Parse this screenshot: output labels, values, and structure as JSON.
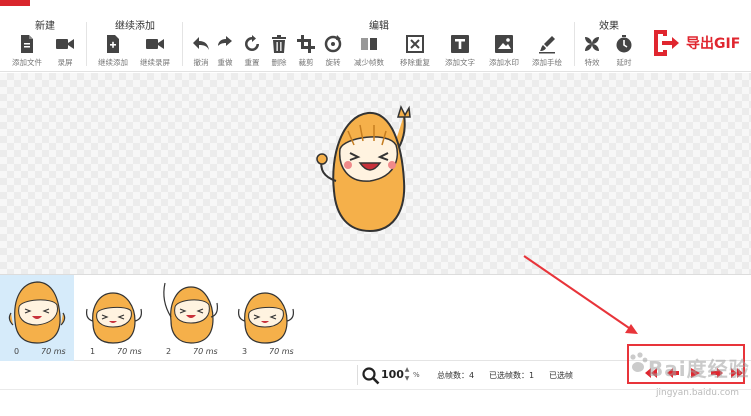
{
  "toolbar": {
    "groups": {
      "new": "新建",
      "continue": "继续添加",
      "edit": "编辑",
      "effects": "效果"
    },
    "tools": {
      "add_file": "添加文件",
      "record_screen": "录屏",
      "continue_add": "继续添加",
      "continue_record": "继续录屏",
      "undo": "撤消",
      "redo": "重做",
      "reset": "重置",
      "delete": "删除",
      "crop": "裁剪",
      "rotate": "旋转",
      "reduce_frames": "减少帧数",
      "remove_duplicate": "移除重复",
      "add_text": "添加文字",
      "add_watermark": "添加水印",
      "add_handwriting": "添加手绘",
      "effects": "特效",
      "delay": "延时"
    },
    "export_label": "导出GIF"
  },
  "frames": [
    {
      "index": "0",
      "duration": "70 ms"
    },
    {
      "index": "1",
      "duration": "70 ms"
    },
    {
      "index": "2",
      "duration": "70 ms"
    },
    {
      "index": "3",
      "duration": "70 ms"
    }
  ],
  "status": {
    "zoom_value": "100",
    "zoom_unit": "%",
    "total_frames": "总帧数：4",
    "selected_frames": "已选帧数：1",
    "selected_partial": "已选帧"
  },
  "watermark": {
    "brand": "Bai度经验",
    "site": "jingyan.baidu.com"
  },
  "colors": {
    "accent": "#e0262f",
    "selection": "#d6ebfa",
    "character": "#f5b04a"
  }
}
